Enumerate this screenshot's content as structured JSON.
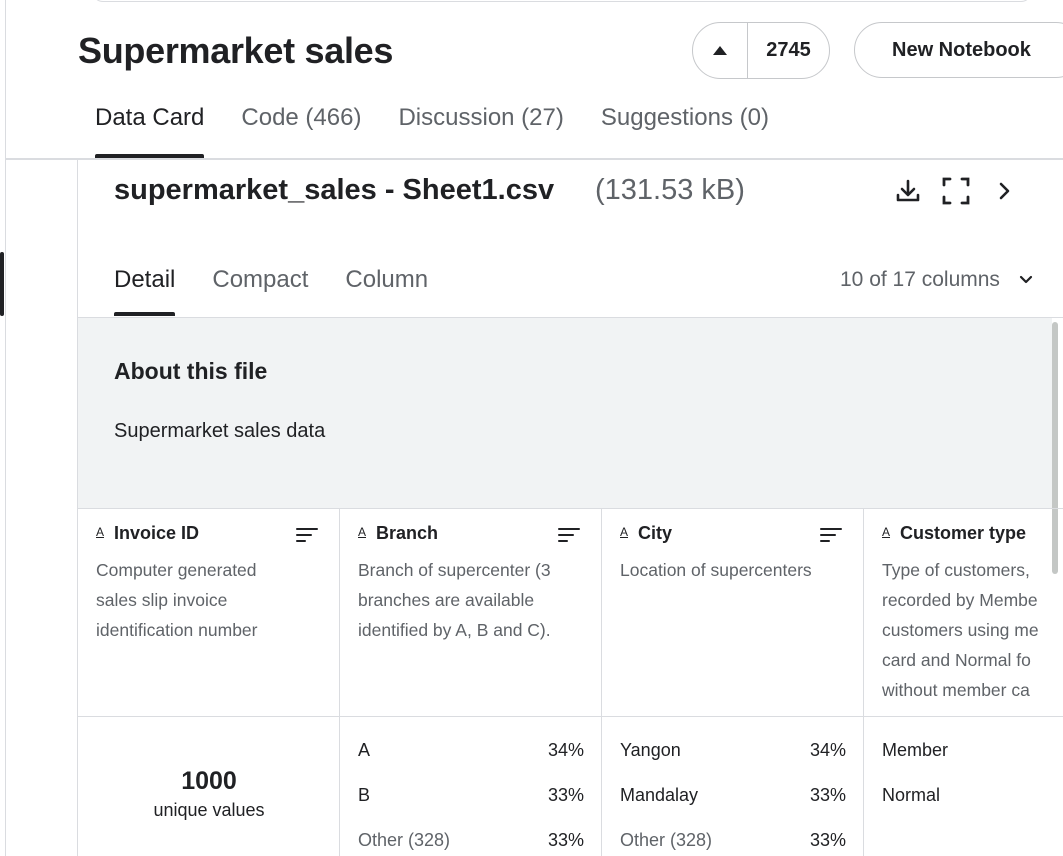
{
  "header": {
    "title": "Supermarket sales",
    "vote_count": "2745",
    "new_notebook_label": "New Notebook"
  },
  "tabs": [
    {
      "label": "Data Card"
    },
    {
      "label": "Code (466)"
    },
    {
      "label": "Discussion (27)"
    },
    {
      "label": "Suggestions (0)"
    }
  ],
  "file": {
    "name": "supermarket_sales - Sheet1.csv",
    "size": "(131.53 kB)",
    "icons": [
      "download-icon",
      "fullscreen-icon",
      "chevron-right-icon"
    ]
  },
  "view_tabs": [
    {
      "label": "Detail"
    },
    {
      "label": "Compact"
    },
    {
      "label": "Column"
    }
  ],
  "columns_selector": "10 of 17 columns",
  "about": {
    "title": "About this file",
    "text": "Supermarket sales data"
  },
  "columns": [
    {
      "type_glyph": "A",
      "name": "Invoice ID",
      "desc_lines": [
        "Computer generated",
        "sales slip invoice",
        "identification number"
      ],
      "stat_value": "1000",
      "stat_label": "unique values"
    },
    {
      "type_glyph": "A",
      "name": "Branch",
      "desc_lines": [
        "Branch of supercenter (3",
        "branches are available",
        "identified by A, B and C)."
      ],
      "rows": [
        {
          "label": "A",
          "pct": "34%"
        },
        {
          "label": "B",
          "pct": "33%"
        },
        {
          "label": "Other (328)",
          "pct": "33%"
        }
      ]
    },
    {
      "type_glyph": "A",
      "name": "City",
      "desc_lines": [
        "Location of supercenters"
      ],
      "rows": [
        {
          "label": "Yangon",
          "pct": "34%"
        },
        {
          "label": "Mandalay",
          "pct": "33%"
        },
        {
          "label": "Other (328)",
          "pct": "33%"
        }
      ]
    },
    {
      "type_glyph": "A",
      "name": "Customer type",
      "desc_lines": [
        "Type of customers,",
        "recorded by Membe",
        "customers using me",
        "card and Normal fo",
        "without member ca"
      ],
      "rows": [
        {
          "label": "Member",
          "pct": ""
        },
        {
          "label": "Normal",
          "pct": ""
        }
      ]
    }
  ]
}
